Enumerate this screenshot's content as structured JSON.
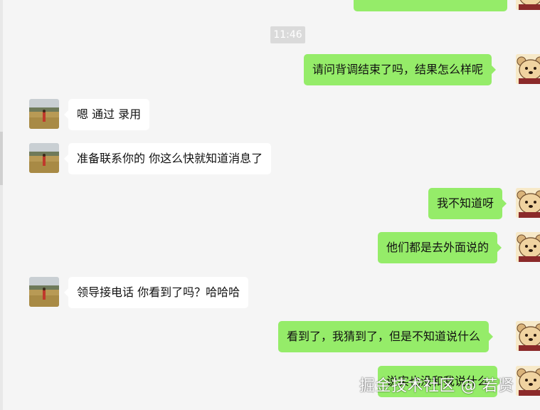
{
  "conversation": {
    "timestamp": "11:46",
    "messages": [
      {
        "side": "out",
        "text": "…"
      },
      {
        "side": "out",
        "text": "请问背调结束了吗，结果怎么样呢"
      },
      {
        "side": "in",
        "text": "嗯 通过 录用"
      },
      {
        "side": "in",
        "text": "准备联系你的  你这么快就知道消息了"
      },
      {
        "side": "out",
        "text": "我不知道呀"
      },
      {
        "side": "out",
        "text": "他们都是去外面说的"
      },
      {
        "side": "in",
        "text": "领导接电话 你看到了吗？哈哈哈"
      },
      {
        "side": "out",
        "text": "看到了，我猜到了，但是不知道说什么"
      },
      {
        "side": "out",
        "text": "说实也没和我说什么"
      }
    ]
  },
  "watermark": "掘金技术社区 @ 若贤",
  "colors": {
    "background": "#f5f5f5",
    "outgoing_bubble": "#95ec69",
    "incoming_bubble": "#ffffff",
    "timestamp_pill": "#dadada"
  },
  "icons": {
    "contact_avatar": "field-landscape-avatar-icon",
    "self_avatar": "cartoon-bear-avatar-icon"
  }
}
